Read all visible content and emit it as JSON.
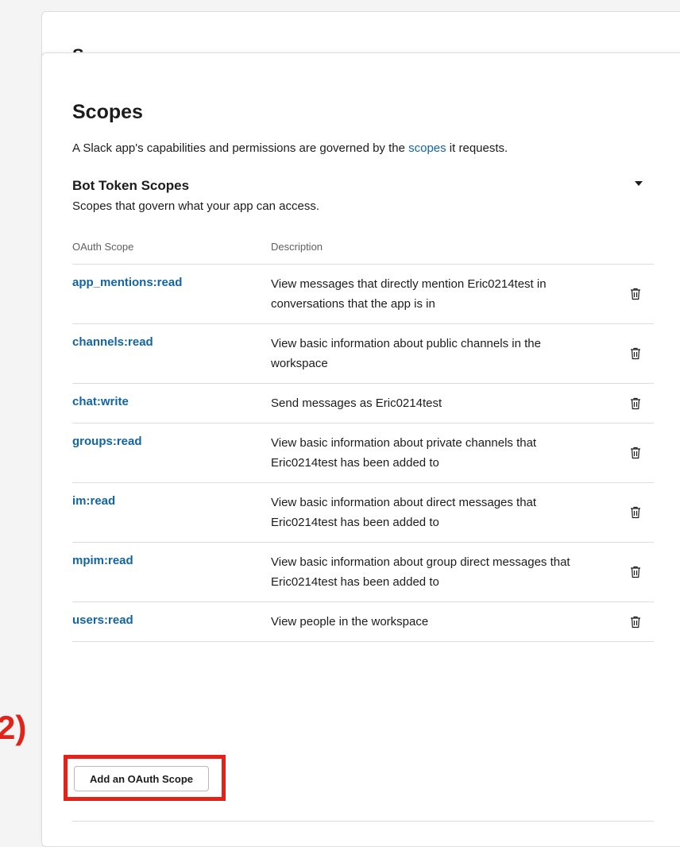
{
  "page": {
    "title": "Scopes",
    "previous_section_title_partial": "S",
    "intro_prefix": "A Slack app's capabilities and permissions are governed by the ",
    "intro_link": "scopes",
    "intro_suffix": " it requests."
  },
  "bot_token": {
    "title": "Bot Token Scopes",
    "subtitle": "Scopes that govern what your app can access."
  },
  "table": {
    "headers": [
      "OAuth Scope",
      "Description"
    ],
    "rows": [
      {
        "scope": "app_mentions:read",
        "desc": "View messages that directly mention Eric0214test in conversations that the app is in"
      },
      {
        "scope": "channels:read",
        "desc": "View basic information about public channels in the workspace"
      },
      {
        "scope": "chat:write",
        "desc": "Send messages as Eric0214test"
      },
      {
        "scope": "groups:read",
        "desc": "View basic information about private channels that Eric0214test has been added to"
      },
      {
        "scope": "im:read",
        "desc": "View basic information about direct messages that Eric0214test has been added to"
      },
      {
        "scope": "mpim:read",
        "desc": "View basic information about group direct messages that Eric0214test has been added to"
      },
      {
        "scope": "users:read",
        "desc": "View people in the workspace"
      }
    ]
  },
  "add_button_label": "Add an OAuth Scope",
  "annotation_label": "2)",
  "colors": {
    "link": "#1264a3",
    "highlight": "#e2231a",
    "border": "#dddddd"
  }
}
